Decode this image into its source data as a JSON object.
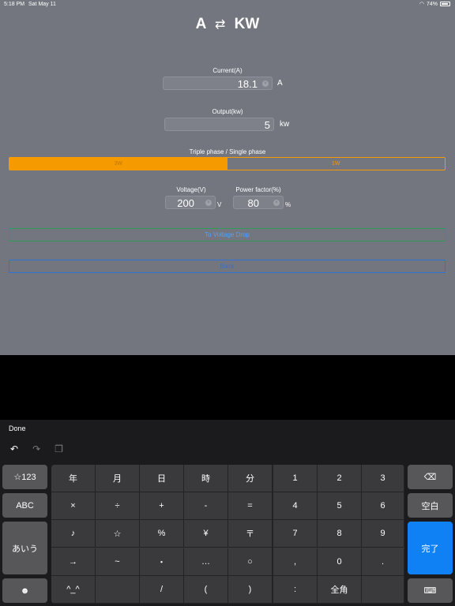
{
  "status": {
    "time": "5:18 PM",
    "date": "Sat May 11",
    "battery": "74%"
  },
  "title": {
    "left": "A",
    "swap_icon": "⇄",
    "right": "KW"
  },
  "current": {
    "label": "Current(A)",
    "value": "18.1",
    "unit": "A"
  },
  "output": {
    "label": "Output(kw)",
    "value": "5",
    "unit": "kw"
  },
  "phase": {
    "label": "Triple phase / Single phase",
    "options": [
      "3W",
      "1W"
    ],
    "selected": "3W"
  },
  "voltage": {
    "label": "Voltage(V)",
    "value": "200",
    "unit": "V"
  },
  "power_factor": {
    "label": "Power factor(%)",
    "value": "80",
    "unit": "%"
  },
  "buttons": {
    "to_voltage_drop": "To Voltage Drop",
    "back": "Back"
  },
  "keyboard": {
    "done": "Done",
    "side_keys": [
      "☆123",
      "ABC",
      "あいう",
      "☻"
    ],
    "right_keys": [
      "⌫",
      "空白",
      "完了",
      "⌨"
    ],
    "grid_left": [
      [
        "年",
        "月",
        "日",
        "時",
        "分"
      ],
      [
        "×",
        "÷",
        "+",
        "-",
        "="
      ],
      [
        "♪",
        "☆",
        "%",
        "¥",
        "〒"
      ],
      [
        "→",
        "~",
        "・",
        "…",
        "○"
      ],
      [
        "^_^",
        "",
        "/",
        "(",
        ")"
      ]
    ],
    "grid_right": [
      [
        "1",
        "2",
        "3"
      ],
      [
        "4",
        "5",
        "6"
      ],
      [
        "7",
        "8",
        "9"
      ],
      [
        ",",
        "0",
        "."
      ],
      [
        ":",
        "全角",
        ""
      ]
    ]
  }
}
